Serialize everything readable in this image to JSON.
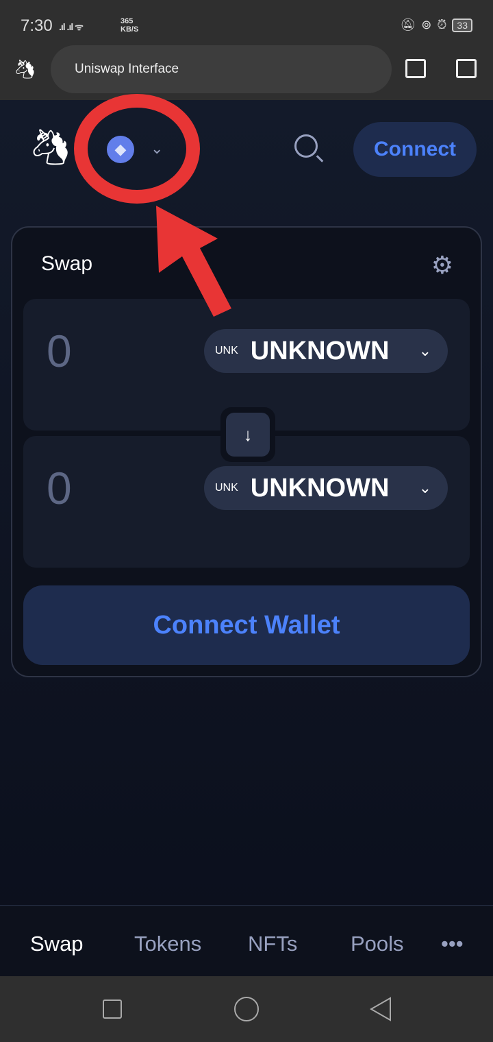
{
  "status_bar": {
    "time": "7:30",
    "speed_value": "365",
    "speed_unit": "KB/S",
    "battery": "33"
  },
  "browser": {
    "title": "Uniswap Interface"
  },
  "header": {
    "connect_label": "Connect"
  },
  "swap": {
    "title": "Swap",
    "input": {
      "amount": "0",
      "token_symbol_small": "UNK",
      "token_name": "UNKNOWN"
    },
    "output": {
      "amount": "0",
      "token_symbol_small": "UNK",
      "token_name": "UNKNOWN"
    },
    "connect_wallet_label": "Connect Wallet"
  },
  "nav": {
    "items": [
      "Swap",
      "Tokens",
      "NFTs",
      "Pools"
    ],
    "more": "•••"
  },
  "colors": {
    "accent": "#4c82fb",
    "annotation": "#e83535"
  }
}
